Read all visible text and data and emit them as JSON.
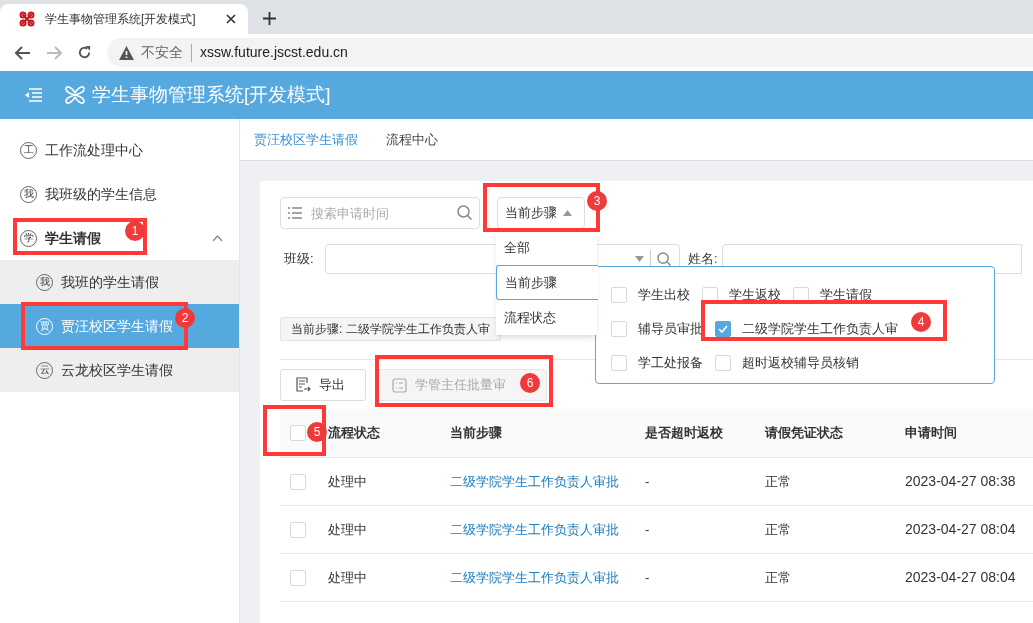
{
  "browser": {
    "tab_title": "学生事物管理系统[开发模式]",
    "security": "不安全",
    "url": "xssw.future.jscst.edu.cn"
  },
  "app": {
    "title": "学生事物管理系统[开发模式]"
  },
  "sidebar": {
    "items": [
      {
        "label": "工作流处理中心",
        "icon": "工",
        "selected": false
      },
      {
        "label": "我班级的学生信息",
        "icon": "我",
        "selected": false
      },
      {
        "label": "学生请假",
        "icon": "学",
        "selected": false,
        "expanded": true,
        "children": [
          {
            "label": "我班的学生请假",
            "icon": "我",
            "selected": false
          },
          {
            "label": "贾汪校区学生请假",
            "icon": "贾",
            "selected": true
          },
          {
            "label": "云龙校区学生请假",
            "icon": "云",
            "selected": false
          }
        ]
      }
    ]
  },
  "page_tabs": [
    {
      "label": "贾汪校区学生请假",
      "selected": true
    },
    {
      "label": "流程中心",
      "selected": false
    }
  ],
  "search": {
    "placeholder": "搜索申请时间"
  },
  "filter_select": {
    "value": "当前步骤",
    "expanded": true,
    "options": [
      {
        "label": "全部",
        "selected": false
      },
      {
        "label": "当前步骤",
        "selected": true
      },
      {
        "label": "流程状态",
        "selected": false
      }
    ]
  },
  "class_filter": {
    "label": "班级:"
  },
  "name_filter": {
    "label": "姓名:"
  },
  "step_option_rows": [
    {
      "options": [
        {
          "label": "学生出校",
          "checked": false
        },
        {
          "label": "学生返校",
          "checked": false
        },
        {
          "label": "学生请假",
          "checked": false
        }
      ]
    },
    {
      "options": [
        {
          "label": "辅导员审批",
          "checked": false
        },
        {
          "label": "二级学院学生工作负责人审",
          "checked": true
        }
      ]
    },
    {
      "options": [
        {
          "label": "学工处报备",
          "checked": false
        },
        {
          "label": "超时返校辅导员核销",
          "checked": false
        }
      ]
    }
  ],
  "active_filter_tag": "当前步骤: 二级学院学生工作负责人审",
  "toolbar": [
    {
      "label": "导出",
      "kind": "export",
      "disabled": false
    },
    {
      "label": "学管主任批量审",
      "kind": "batch",
      "disabled": true
    }
  ],
  "table": {
    "select_all": {
      "checked": false
    },
    "columns": [
      "流程状态",
      "当前步骤",
      "是否超时返校",
      "请假凭证状态",
      "申请时间"
    ],
    "rows": [
      {
        "checked": false,
        "cells": [
          "处理中",
          "二级学院学生工作负责人审批",
          "-",
          "正常",
          "2023-04-27 08:38"
        ]
      },
      {
        "checked": false,
        "cells": [
          "处理中",
          "二级学院学生工作负责人审批",
          "-",
          "正常",
          "2023-04-27 08:04"
        ]
      },
      {
        "checked": false,
        "cells": [
          "处理中",
          "二级学院学生工作负责人审批",
          "-",
          "正常",
          "2023-04-27 08:04"
        ]
      }
    ]
  },
  "annotations": [
    {
      "number": "1"
    },
    {
      "number": "2"
    },
    {
      "number": "3"
    },
    {
      "number": "4"
    },
    {
      "number": "5"
    },
    {
      "number": "6"
    }
  ]
}
